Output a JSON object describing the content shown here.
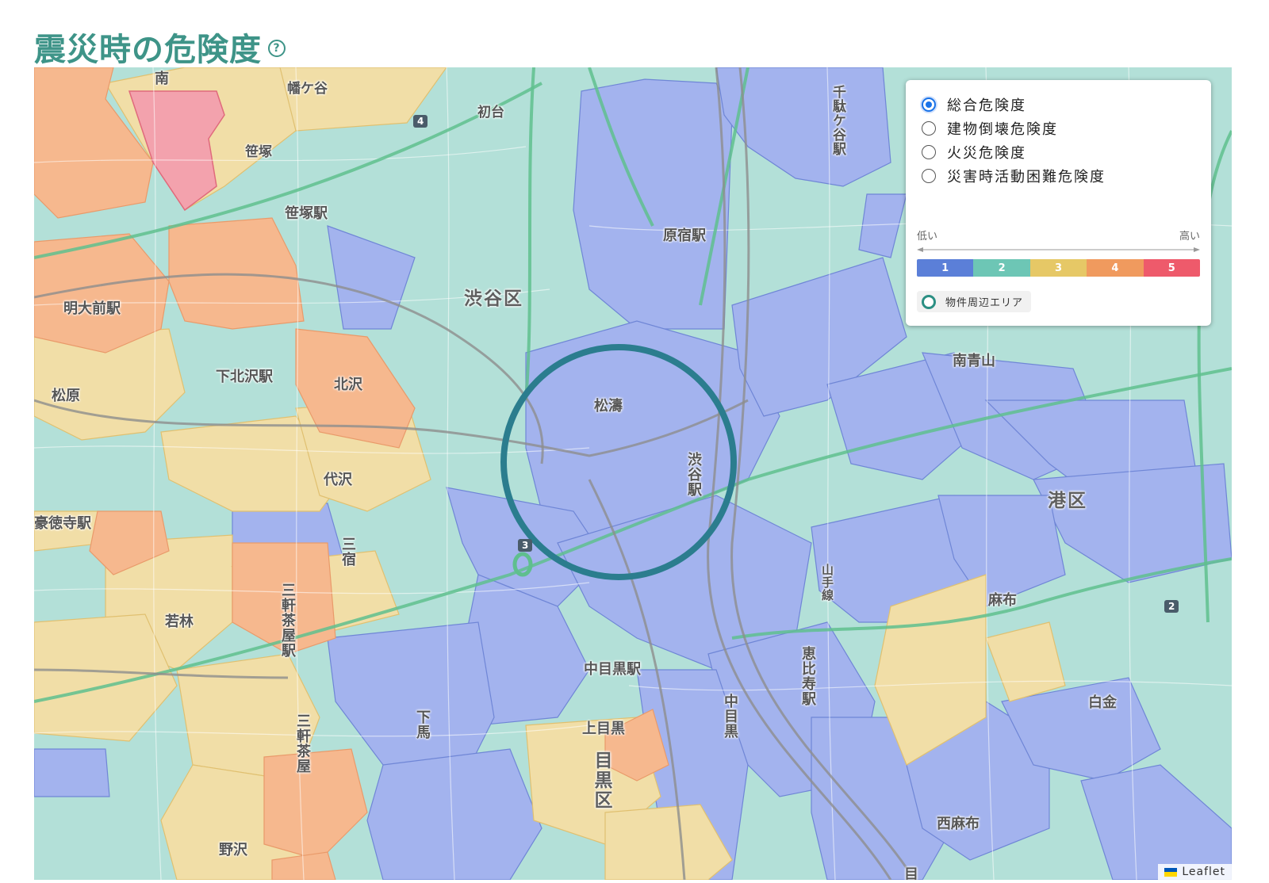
{
  "header": {
    "title": "震災時の危険度",
    "help_icon": "?"
  },
  "legend": {
    "options": [
      {
        "label": "総合危険度",
        "checked": true
      },
      {
        "label": "建物倒壊危険度",
        "checked": false
      },
      {
        "label": "火災危険度",
        "checked": false
      },
      {
        "label": "災害時活動困難危険度",
        "checked": false
      }
    ],
    "scale_low": "低い",
    "scale_high": "高い",
    "levels": [
      {
        "label": "1",
        "color": "#5b7fd8"
      },
      {
        "label": "2",
        "color": "#6dc6b5"
      },
      {
        "label": "3",
        "color": "#e6c866"
      },
      {
        "label": "4",
        "color": "#f09a5e"
      },
      {
        "label": "5",
        "color": "#ee5a6b"
      }
    ],
    "area_label": "物件周辺エリア"
  },
  "map": {
    "labels": {
      "shibuya_ku": "渋谷区",
      "minato_ku": "港区",
      "meguro_ku": "目黒区",
      "harajuku": "原宿駅",
      "sendagaya": "千駄ケ谷駅",
      "shibuya_st": "渋谷駅",
      "shoto": "松濤",
      "minami_aoyama": "南青山",
      "azabu": "麻布",
      "shirokane": "白金",
      "hatsudai": "初台",
      "sasazuka": "笹塚",
      "sasazuka_st": "笹塚駅",
      "hatagaya": "幡ケ谷",
      "meidaimae": "明大前駅",
      "shimokitazawa": "下北沢駅",
      "kitazawa": "北沢",
      "matsubara": "松原",
      "daizawa": "代沢",
      "gotokuji": "豪徳寺駅",
      "mishuku": "三宿",
      "sangenjaya_st": "三軒茶屋駅",
      "wakabayashi": "若林",
      "sangenjaya": "三軒茶屋",
      "nozawa": "野沢",
      "shimouma": "下馬",
      "nakameguro_st": "中目黒駅",
      "kamimeguro": "上目黒",
      "nakameguro": "中目黒",
      "ebisu": "恵比寿駅",
      "yamanote": "山手線",
      "nishi_azabu_lower": "西麻布",
      "minami_partial": "南",
      "me_partial": "目"
    },
    "route_markers": [
      "4",
      "3",
      "2"
    ],
    "attribution": "Leaflet"
  }
}
